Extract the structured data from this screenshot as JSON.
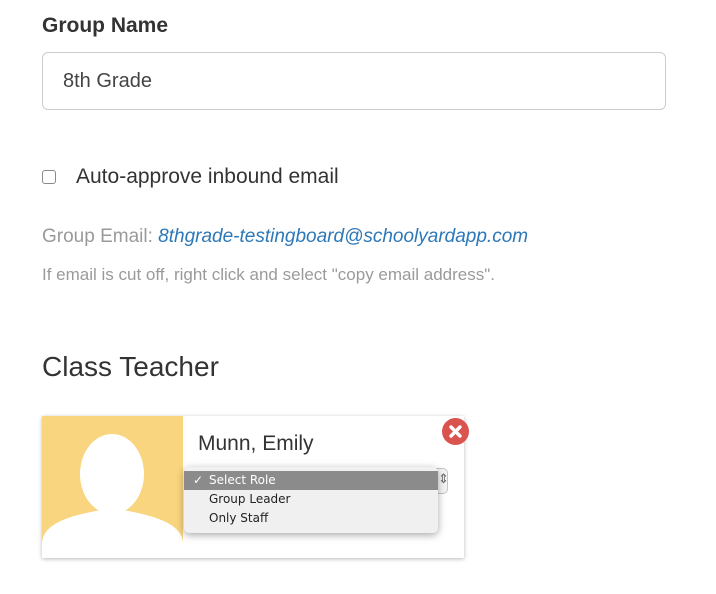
{
  "group_name": {
    "label": "Group Name",
    "value": "8th Grade"
  },
  "auto_approve": {
    "label": "Auto-approve inbound email",
    "checked": false
  },
  "group_email": {
    "prefix": "Group Email:",
    "address": "8thgrade-testingboard@schoolyardapp.com",
    "hint": "If email is cut off, right click and select \"copy email address\"."
  },
  "class_teacher": {
    "title": "Class Teacher",
    "teacher": {
      "name": "Munn, Emily",
      "avatar_icon": "person-silhouette-icon",
      "remove_icon": "close-icon"
    },
    "role_select": {
      "selected": "Select Role",
      "options": [
        {
          "label": "Select Role",
          "selected": true
        },
        {
          "label": "Group Leader",
          "selected": false
        },
        {
          "label": "Only Staff",
          "selected": false
        }
      ]
    }
  },
  "colors": {
    "avatar_bg": "#f8d57e",
    "remove_button": "#d9534f",
    "link": "#2c78b8",
    "muted_text": "#9a9a9a"
  }
}
